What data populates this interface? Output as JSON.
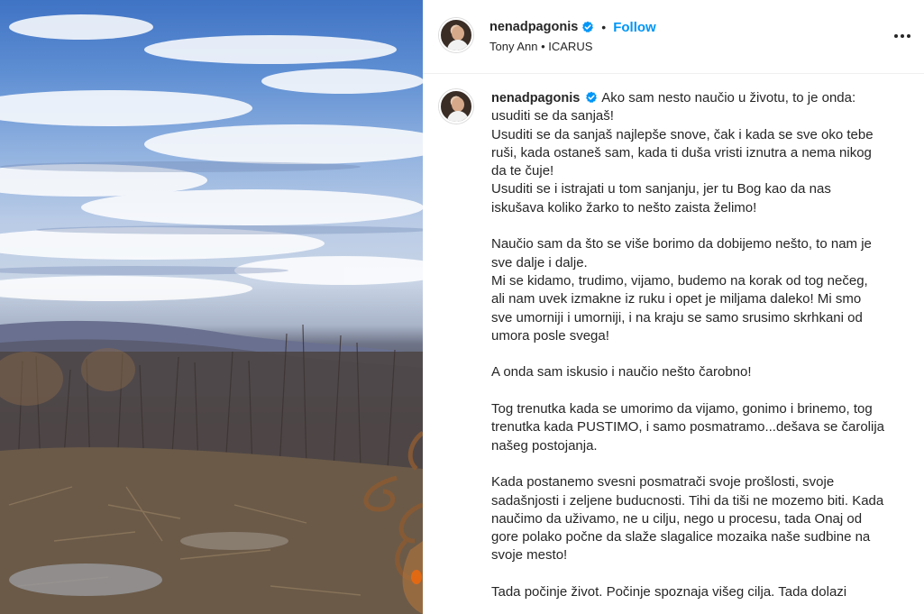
{
  "post": {
    "username": "nenadpagonis",
    "follow_label": "Follow",
    "separator": "•",
    "audio": "Tony Ann • ICARUS",
    "caption_lines": [
      "Ako sam nesto naučio u životu, to je onda:",
      "usuditi se da sanjaš!",
      "Usuditi se da sanjaš najlepše snove, čak i kada se sve oko tebe",
      "ruši, kada ostaneš sam, kada ti duša vristi iznutra a nema nikog",
      "da te čuje!",
      "Usuditi se i istrajati u tom sanjanju, jer tu Bog kao da nas",
      "iskušava koliko žarko to nešto zaista želimo!",
      "",
      "Naučio sam da što se više borimo da dobijemo nešto, to nam je",
      "sve dalje i dalje.",
      "Mi se kidamo, trudimo, vijamo, budemo na korak od tog nečeg,",
      "ali nam uvek izmakne iz ruku i opet je miljama daleko! Mi smo",
      "sve umorniji i umorniji, i na kraju se samo srusimo skrhkani od",
      "umora posle svega!",
      "",
      "A onda sam iskusio i naučio nešto čarobno!",
      "",
      "Tog trenutka kada se umorimo da vijamo, gonimo i brinemo, tog",
      "trenutka kada PUSTIMO, i samo posmatramo...dešava se čarolija",
      "našeg postojanja.",
      "",
      "Kada postanemo svesni posmatrači svoje prošlosti, svoje",
      "sadašnjosti i zeljene buducnosti. Tihi da tiši ne mozemo biti. Kada",
      "naučimo da uživamo, ne u cilju, nego u procesu, tada Onaj od",
      "gore polako počne da slaže slagalice mozaika naše sudbine na",
      "svoje mesto!",
      "",
      "Tada počinje život. Počinje spoznaja višeg cilja. Tada dolazi"
    ]
  },
  "colors": {
    "accent": "#0095f6",
    "verified": "#0095f6",
    "text": "#262626",
    "divider": "#efefef"
  },
  "icons": {
    "verified": "verified-badge-icon",
    "more": "more-options-icon"
  }
}
